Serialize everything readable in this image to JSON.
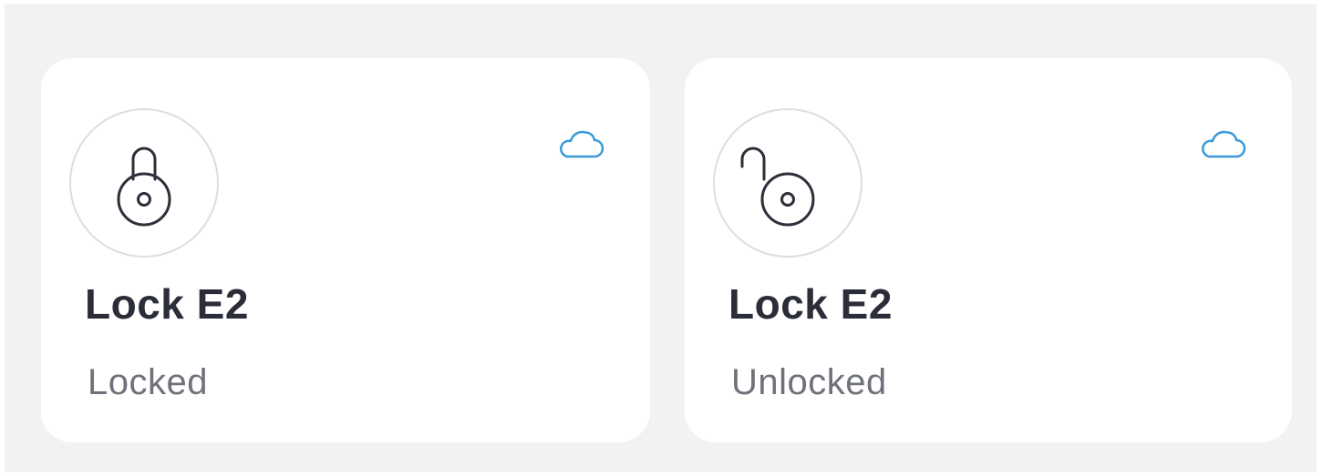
{
  "devices": [
    {
      "name": "Lock E2",
      "status": "Locked",
      "lock_icon": "padlock-closed-icon",
      "connection_icon": "cloud-icon"
    },
    {
      "name": "Lock E2",
      "status": "Unlocked",
      "lock_icon": "padlock-open-icon",
      "connection_icon": "cloud-icon"
    }
  ],
  "colors": {
    "background": "#f2f2f2",
    "card": "#ffffff",
    "title": "#2b2d38",
    "status": "#6f727a",
    "icon_stroke": "#2d2f3a",
    "cloud": "#3a9ad9",
    "circle_border": "#dddddd"
  }
}
